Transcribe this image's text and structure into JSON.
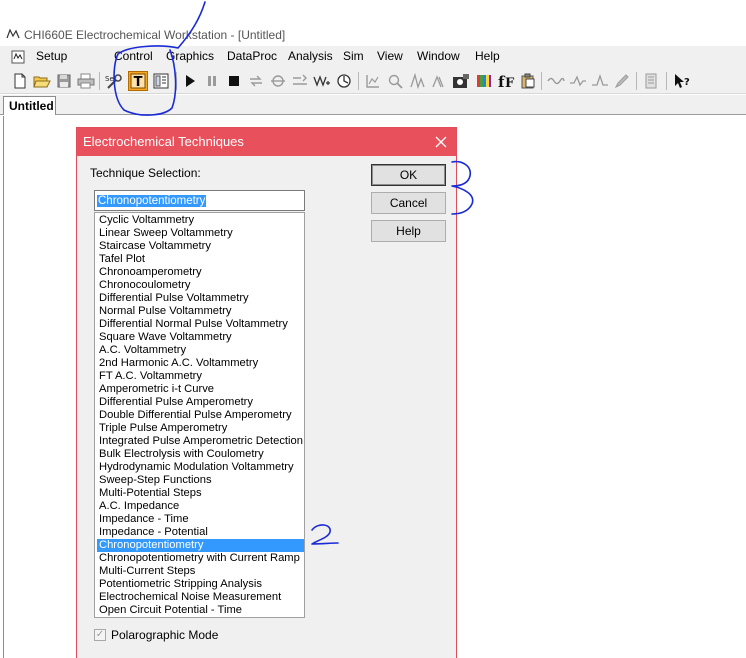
{
  "window": {
    "title": "CHI660E Electrochemical Workstation - [Untitled]",
    "app_icon_text": "CHI"
  },
  "menubar": {
    "items": [
      "Setup",
      "Control",
      "Graphics",
      "DataProc",
      "Analysis",
      "Sim",
      "View",
      "Window",
      "Help"
    ]
  },
  "toolbar": {
    "icons": [
      "new-document",
      "open-folder",
      "save-disk",
      "print",
      "setup-wrench",
      "technique-t",
      "parameters",
      "run-play",
      "pause",
      "stop",
      "reverse-scan",
      "ir-compensation",
      "filter",
      "cell-stand",
      "open-circuit",
      "graph-view",
      "zoom",
      "overlay-plot",
      "add-plot",
      "info-image",
      "color-bars",
      "font-f",
      "copy-clipboard",
      "smooth-wave",
      "derivative-wave",
      "integrate-wave",
      "pen",
      "list-notes",
      "help-pointer"
    ],
    "setup_label": "Set",
    "highlight_color": "#f5a623"
  },
  "tabs": {
    "document": "Untitled"
  },
  "dialog": {
    "title": "Electrochemical Techniques",
    "title_color": "#e8505c",
    "selection_label": "Technique Selection:",
    "selected_value": "Chronopotentiometry",
    "ok_label": "OK",
    "cancel_label": "Cancel",
    "help_label": "Help",
    "polarographic_label": "Polarographic Mode",
    "polarographic_checked": true,
    "polarographic_disabled": true,
    "techniques": [
      "Cyclic Voltammetry",
      "Linear Sweep Voltammetry",
      "Staircase Voltammetry",
      "Tafel Plot",
      "Chronoamperometry",
      "Chronocoulometry",
      "Differential Pulse Voltammetry",
      "Normal Pulse Voltammetry",
      "Differential Normal Pulse Voltammetry",
      "Square Wave Voltammetry",
      "A.C. Voltammetry",
      "2nd Harmonic A.C. Voltammetry",
      "FT A.C. Voltammetry",
      "Amperometric i-t Curve",
      "Differential Pulse Amperometry",
      "Double Differential Pulse Amperometry",
      "Triple Pulse Amperometry",
      "Integrated Pulse Amperometric Detection",
      "Bulk Electrolysis with Coulometry",
      "Hydrodynamic Modulation Voltammetry",
      "Sweep-Step Functions",
      "Multi-Potential Steps",
      "A.C. Impedance",
      "Impedance - Time",
      "Impedance - Potential",
      "Chronopotentiometry",
      "Chronopotentiometry with Current Ramp",
      "Multi-Current Steps",
      "Potentiometric Stripping Analysis",
      "Electrochemical Noise Measurement",
      "Open Circuit Potential - Time"
    ],
    "selected_index": 25
  },
  "annotations": {
    "ink_color": "#1a2bd6",
    "step_2": "2",
    "step_3": "3"
  }
}
